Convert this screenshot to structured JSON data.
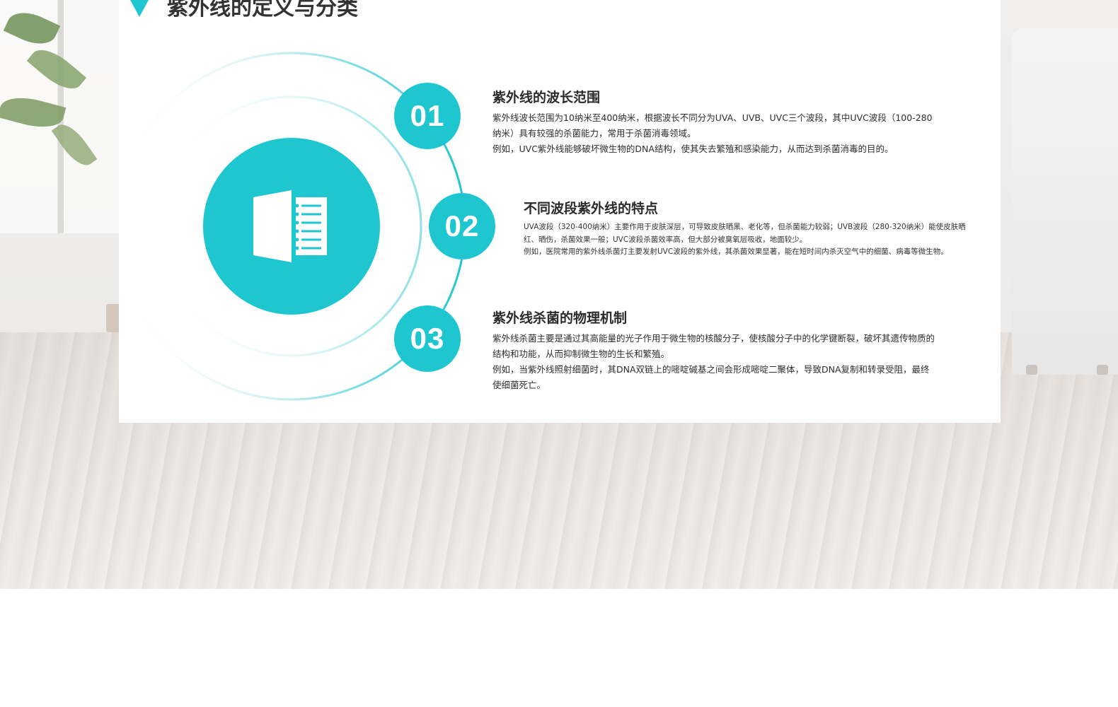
{
  "slide": {
    "title": "紫外线的定义与分类",
    "center_icon": "book-icon",
    "items": [
      {
        "number": "01",
        "heading": "紫外线的波长范围",
        "paragraphs": [
          "紫外线波长范围为10纳米至400纳米，根据波长不同分为UVA、UVB、UVC三个波段，其中UVC波段（100-280纳米）具有较强的杀菌能力，常用于杀菌消毒领域。",
          "例如，UVC紫外线能够破坏微生物的DNA结构，使其失去繁殖和感染能力，从而达到杀菌消毒的目的。"
        ]
      },
      {
        "number": "02",
        "heading": "不同波段紫外线的特点",
        "paragraphs": [
          "UVA波段（320-400纳米）主要作用于皮肤深层，可导致皮肤晒黑、老化等，但杀菌能力较弱；UVB波段（280-320纳米）能使皮肤晒红、晒伤，杀菌效果一般；UVC波段杀菌效率高，但大部分被臭氧层吸收，地面较少。",
          "例如，医院常用的紫外线杀菌灯主要发射UVC波段的紫外线，其杀菌效果显著，能在短时间内杀灭空气中的细菌、病毒等微生物。"
        ]
      },
      {
        "number": "03",
        "heading": "紫外线杀菌的物理机制",
        "paragraphs": [
          "紫外线杀菌主要是通过其高能量的光子作用于微生物的核酸分子，使核酸分子中的化学键断裂，破坏其遗传物质的结构和功能，从而抑制微生物的生长和繁殖。",
          "例如，当紫外线照射细菌时，其DNA双链上的嘧啶碱基之间会形成嘧啶二聚体，导致DNA复制和转录受阻，最终使细菌死亡。"
        ]
      }
    ]
  },
  "colors": {
    "accent": "#1ec6cf",
    "ring": "#bfeff2",
    "text": "#2b2b2b"
  }
}
